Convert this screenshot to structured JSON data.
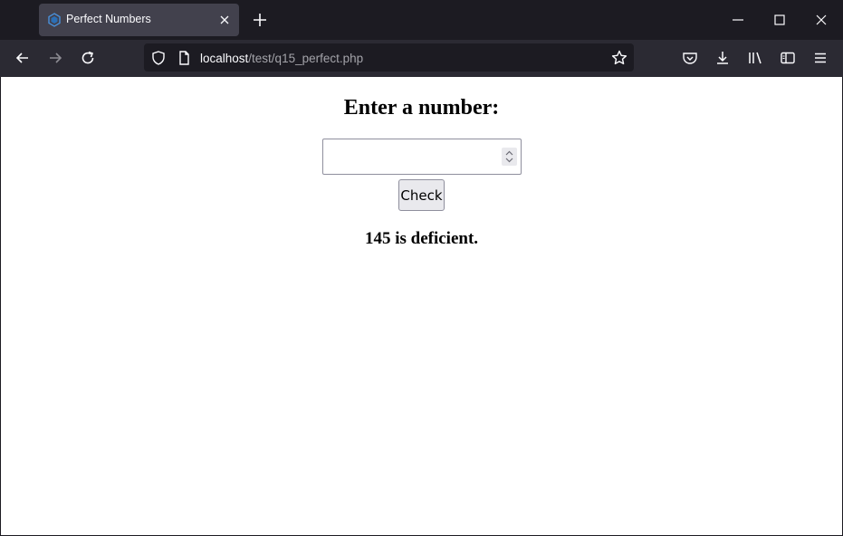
{
  "browser": {
    "tab": {
      "title": "Perfect Numbers",
      "favicon": "php-favicon-icon"
    },
    "url": {
      "host": "localhost",
      "path": "/test/q15_perfect.php"
    },
    "colors": {
      "chrome": "#1c1b22",
      "toolbar": "#2b2a33",
      "active_tab": "#42414d"
    }
  },
  "page": {
    "heading": "Enter a number:",
    "input": {
      "value": "",
      "placeholder": ""
    },
    "check_label": "Check",
    "result": "145 is deficient."
  }
}
